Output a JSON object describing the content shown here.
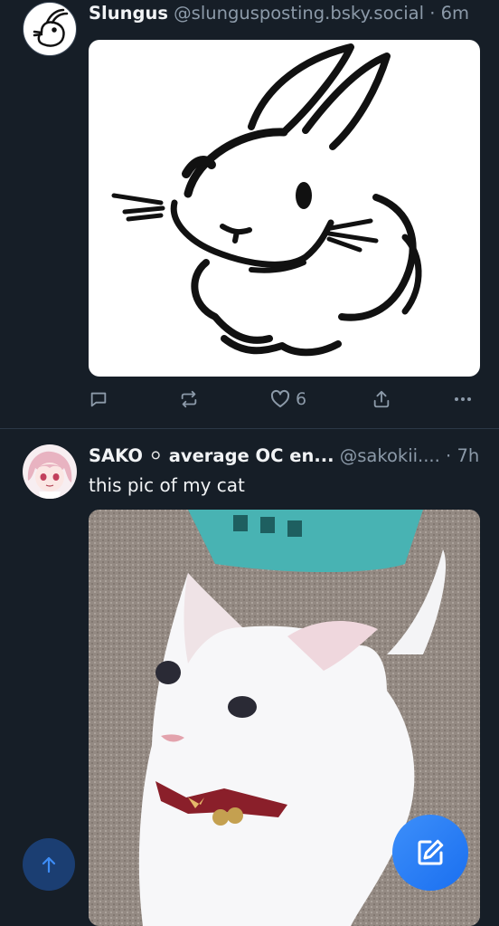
{
  "posts": [
    {
      "display_name": "Slungus",
      "handle": "@slungusposting.bsky.social",
      "separator": "·",
      "time": "6m",
      "text": "",
      "media_icon": "bunny-drawing",
      "actions": {
        "reply": "reply-icon",
        "repost": "repost-icon",
        "like": "heart-icon",
        "like_count": "6",
        "share": "share-icon",
        "more": "more-icon"
      }
    },
    {
      "display_name": "SAKO",
      "badge": "⚪",
      "display_name_rest": "average OC en...",
      "handle": "@sakokii....",
      "separator": "·",
      "time": "7h",
      "text": "this pic of my cat",
      "media_icon": "white-cat-photo"
    }
  ],
  "fab": {
    "scroll_top": "arrow-up-icon",
    "compose": "compose-icon"
  },
  "colors": {
    "background": "#161e27",
    "accent": "#1f7cf2",
    "muted": "#8c9aa9",
    "divider": "#2b3847"
  }
}
